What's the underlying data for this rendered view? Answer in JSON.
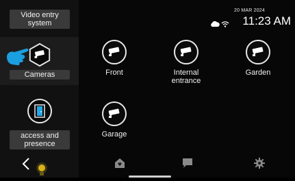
{
  "status": {
    "date": "20 MAR 2024",
    "time": "11:23 AM",
    "icons": [
      "cloud-icon",
      "wifi-icon"
    ]
  },
  "sidebar": {
    "items": [
      {
        "label": "Video entry system",
        "icon": "intercom-icon",
        "active": false
      },
      {
        "label": "Cameras",
        "icon": "camera-icon",
        "active": true
      },
      {
        "label": "access and presence",
        "icon": "door-icon",
        "active": false
      }
    ]
  },
  "cameras": [
    {
      "label": "Front",
      "icon": "camera-icon"
    },
    {
      "label": "Internal entrance",
      "icon": "camera-icon"
    },
    {
      "label": "Garden",
      "icon": "camera-icon"
    },
    {
      "label": "Garage",
      "icon": "camera-icon"
    }
  ],
  "bottom_nav": {
    "icons": [
      "back-icon",
      "light-bulb-icon",
      "home-icon",
      "chat-icon",
      "settings-icon"
    ]
  },
  "colors": {
    "accent": "#1aa0e0",
    "door_blue": "#22a8e6",
    "bulb_yellow": "#d8b218",
    "icon_grey": "#8a8a8a"
  }
}
